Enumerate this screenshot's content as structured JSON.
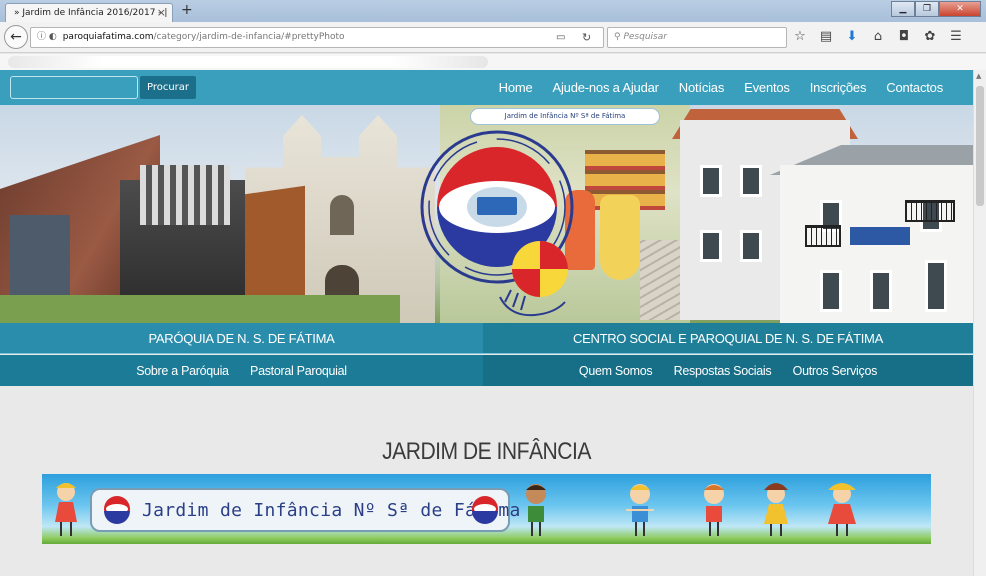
{
  "browser": {
    "tab_title": "» Jardim de Infância 2016/2017 - |",
    "tab_close": "×",
    "new_tab": "+",
    "url_host": "paroquiafatima.com",
    "url_path": "/category/jardim-de-infancia/#prettyPhoto",
    "search_placeholder": "Pesquisar",
    "window_buttons": [
      "minimize",
      "maximize",
      "close"
    ]
  },
  "site": {
    "search_button": "Procurar",
    "menu": [
      "Home",
      "Ajude-nos a Ajudar",
      "Notícias",
      "Eventos",
      "Inscrições",
      "Contactos"
    ],
    "hero_label": "Jardim de Infância Nº Sª de Fátima",
    "left_section": {
      "title": "PARÓQUIA DE N. S. DE FÁTIMA",
      "links": [
        "Sobre a Paróquia",
        "Pastoral Paroquial"
      ]
    },
    "right_section": {
      "title": "CENTRO SOCIAL E PAROQUIAL DE N. S. DE FÁTIMA",
      "links": [
        "Quem Somos",
        "Respostas Sociais",
        "Outros Serviços"
      ]
    },
    "page_heading": "JARDIM DE INFÂNCIA",
    "banner_text": "Jardim de Infância Nº Sª de Fátima"
  },
  "colors": {
    "topnav": "#3a9fbc",
    "section_left": "#2b8dac",
    "section_right": "#1f7f99",
    "search_button": "#1b6f8a"
  }
}
